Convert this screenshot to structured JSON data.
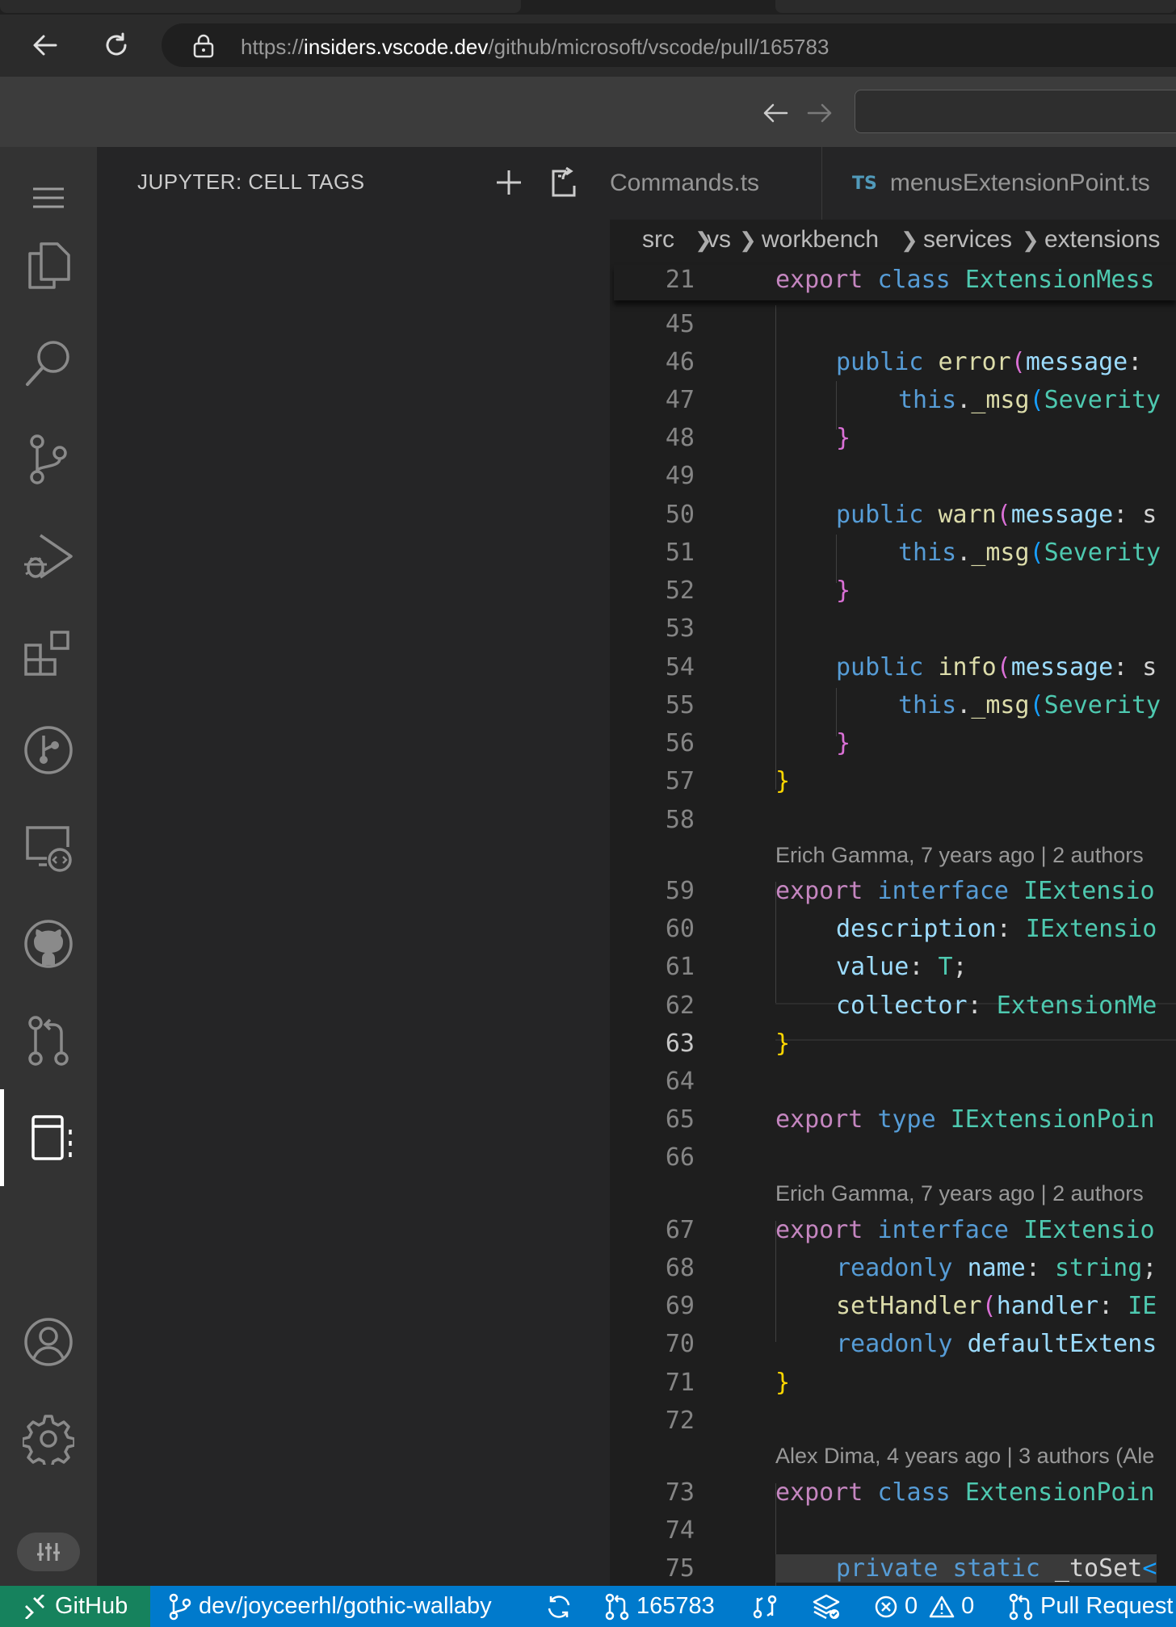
{
  "browser": {
    "url_prefix": "https://",
    "url_host": "insiders.vscode.dev",
    "url_path": "/github/microsoft/vscode/pull/165783"
  },
  "sidebar": {
    "title": "JUPYTER: CELL TAGS"
  },
  "activity_bar": {
    "items": [
      "menu-icon",
      "explorer-icon",
      "search-icon",
      "source-control-icon",
      "run-debug-icon",
      "extensions-icon",
      "git-graph-icon",
      "remote-explorer-icon",
      "github-icon",
      "pull-requests-icon",
      "jupyter-cell-tags-icon"
    ],
    "bottom": [
      "accounts-icon",
      "manage-gear-icon",
      "customize-layout-icon"
    ],
    "active": "jupyter-cell-tags-icon"
  },
  "editor": {
    "tabs": [
      {
        "label": "Commands.ts",
        "icon": ""
      },
      {
        "label": "menusExtensionPoint.ts",
        "icon": "TS"
      }
    ],
    "breadcrumbs": [
      "src",
      "vs",
      "workbench",
      "services",
      "extensions"
    ],
    "sticky_line": {
      "number": "21"
    },
    "line_numbers": [
      "45",
      "46",
      "47",
      "48",
      "49",
      "50",
      "51",
      "52",
      "53",
      "54",
      "55",
      "56",
      "57",
      "58",
      "59",
      "60",
      "61",
      "62",
      "63",
      "64",
      "65",
      "66",
      "67",
      "68",
      "69",
      "70",
      "71",
      "72",
      "73",
      "74",
      "75"
    ],
    "codelens": [
      "Erich Gamma, 7 years ago | 2 authors",
      "Erich Gamma, 7 years ago | 2 authors",
      "Alex Dima, 4 years ago | 3 authors (Ale"
    ],
    "current_line": "63"
  },
  "status_bar": {
    "remote": "GitHub",
    "branch": "dev/joyceerhl/gothic-wallaby",
    "pr_number": "165783",
    "errors": "0",
    "warnings": "0",
    "pull_request": "Pull Request"
  },
  "colors": {
    "status_bar": "#007acc",
    "remote": "#16825d",
    "activity_bar": "#333333",
    "side_bar": "#252526",
    "editor": "#1e1e1e"
  }
}
